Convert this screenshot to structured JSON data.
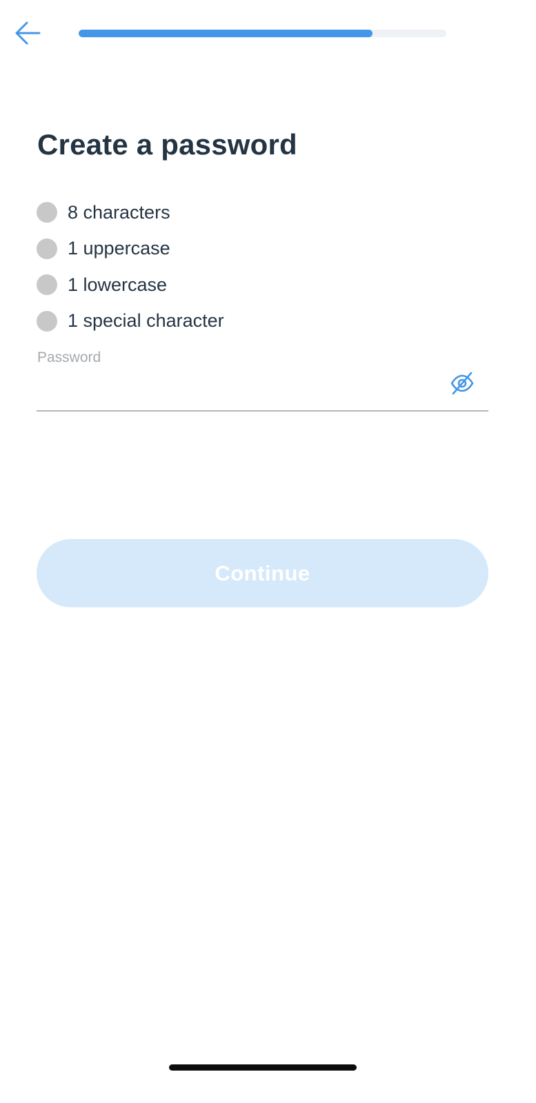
{
  "header": {
    "back_icon": "arrow-left-icon",
    "progress_fraction": 0.8,
    "progress_color": "#4396e8",
    "progress_track_color": "#eef1f5"
  },
  "title": "Create a password",
  "requirements": [
    {
      "label": "8 characters",
      "met": false
    },
    {
      "label": "1 uppercase",
      "met": false
    },
    {
      "label": "1 lowercase",
      "met": false
    },
    {
      "label": "1 special character",
      "met": false
    }
  ],
  "password_field": {
    "label": "Password",
    "value": "",
    "visibility_icon": "eye-off-icon",
    "accent_color": "#4396e8"
  },
  "continue_button": {
    "label": "Continue",
    "enabled": false,
    "background_color": "#d5e9fb"
  }
}
